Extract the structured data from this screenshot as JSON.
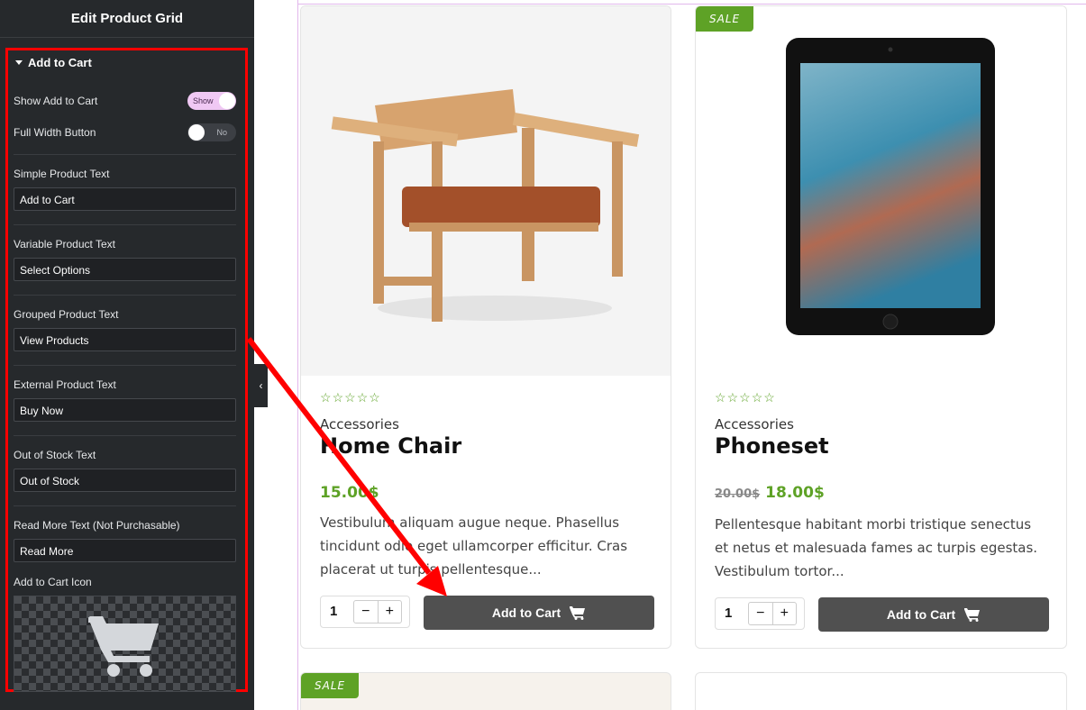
{
  "panel": {
    "title": "Edit Product Grid",
    "section_title": "Add to Cart",
    "show_add_to_cart": {
      "label": "Show Add to Cart",
      "toggle_text": "Show"
    },
    "full_width_button": {
      "label": "Full Width Button",
      "toggle_text": "No"
    },
    "fields": [
      {
        "label": "Simple Product Text",
        "value": "Add to Cart"
      },
      {
        "label": "Variable Product Text",
        "value": "Select Options"
      },
      {
        "label": "Grouped Product Text",
        "value": "View Products"
      },
      {
        "label": "External Product Text",
        "value": "Buy Now"
      },
      {
        "label": "Out of Stock Text",
        "value": "Out of Stock"
      },
      {
        "label": "Read More Text (Not Purchasable)",
        "value": "Read More"
      }
    ],
    "icon_label": "Add to Cart Icon",
    "icon_name": "shopping-cart-icon",
    "collapse_glyph": "‹"
  },
  "products": [
    {
      "sale_badge": "",
      "rating": 0,
      "category": "Accessories",
      "title": "Home Chair",
      "old_price": "",
      "price": "15.00$",
      "description": "Vestibulum aliquam augue neque. Phasellus tincidunt odio eget ullamcorper efficitur. Cras placerat ut turpis pellentesque...",
      "qty": "1",
      "button": "Add to Cart"
    },
    {
      "sale_badge": "SALE",
      "rating": 0,
      "category": "Accessories",
      "title": "Phoneset",
      "old_price": "20.00$",
      "price": "18.00$",
      "description": "Pellentesque habitant morbi tristique senectus et netus et malesuada fames ac turpis egestas. Vestibulum tortor...",
      "qty": "1",
      "button": "Add to Cart"
    }
  ],
  "next_row": {
    "sale_badge": "SALE"
  },
  "colors": {
    "accent_green": "#5ea226",
    "panel_bg": "#26292c",
    "highlight_red": "#ff0000",
    "toggle_on": "#f0c8f4"
  },
  "qty_minus": "−",
  "qty_plus": "+",
  "star_glyph": "☆"
}
